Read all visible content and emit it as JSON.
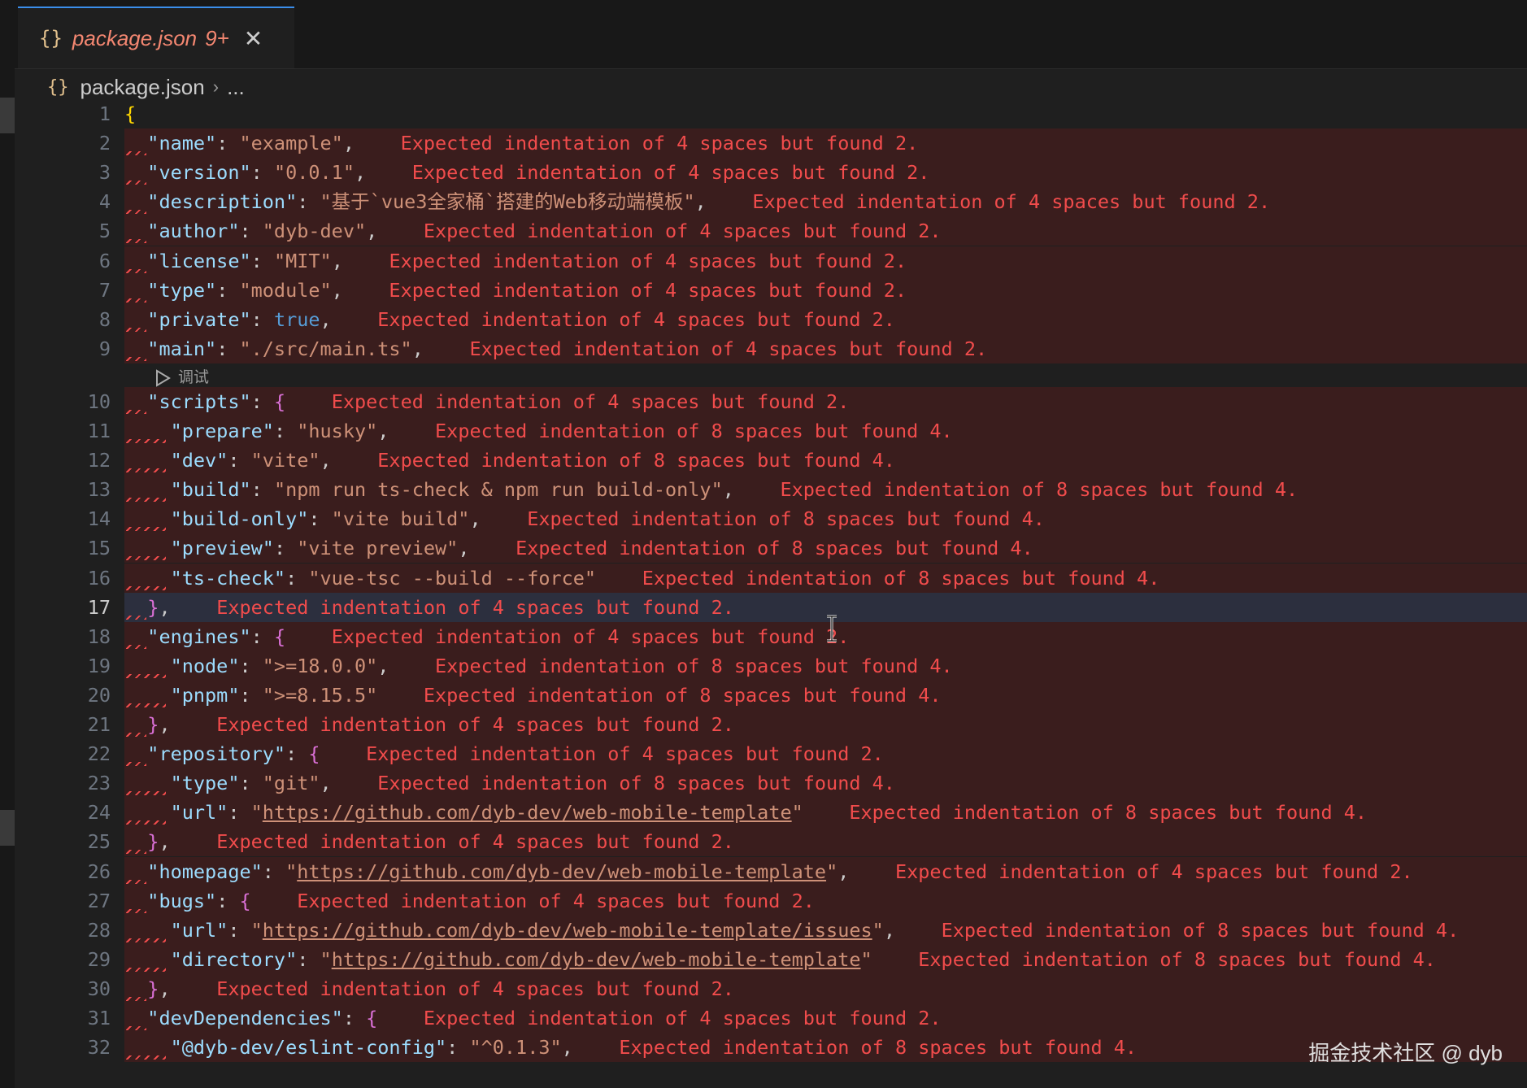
{
  "tab": {
    "icon": "{}",
    "filename": "package.json",
    "problem_count": "9+"
  },
  "breadcrumb": {
    "icon": "{}",
    "file": "package.json",
    "rest": "..."
  },
  "codelens": {
    "label": "调试"
  },
  "watermark": "掘金技术社区 @ dyb",
  "lines": [
    {
      "n": "1",
      "tokens": [
        [
          "br1",
          "{"
        ]
      ],
      "msg": ""
    },
    {
      "n": "2",
      "tokens": [
        [
          "p",
          "  "
        ],
        [
          "k",
          "\"name\""
        ],
        [
          "p",
          ": "
        ],
        [
          "s",
          "\"example\""
        ],
        [
          "p",
          ","
        ]
      ],
      "msg": "Expected indentation of 4 spaces but found 2."
    },
    {
      "n": "3",
      "tokens": [
        [
          "p",
          "  "
        ],
        [
          "k",
          "\"version\""
        ],
        [
          "p",
          ": "
        ],
        [
          "s",
          "\"0.0.1\""
        ],
        [
          "p",
          ","
        ]
      ],
      "msg": "Expected indentation of 4 spaces but found 2."
    },
    {
      "n": "4",
      "tokens": [
        [
          "p",
          "  "
        ],
        [
          "k",
          "\"description\""
        ],
        [
          "p",
          ": "
        ],
        [
          "s",
          "\"基于`vue3全家桶`搭建的Web移动端模板\""
        ],
        [
          "p",
          ","
        ]
      ],
      "msg": "Expected indentation of 4 spaces but found 2."
    },
    {
      "n": "5",
      "tokens": [
        [
          "p",
          "  "
        ],
        [
          "k",
          "\"author\""
        ],
        [
          "p",
          ": "
        ],
        [
          "s",
          "\"dyb-dev\""
        ],
        [
          "p",
          ","
        ]
      ],
      "msg": "Expected indentation of 4 spaces but found 2."
    },
    {
      "n": "6",
      "tokens": [
        [
          "p",
          "  "
        ],
        [
          "k",
          "\"license\""
        ],
        [
          "p",
          ": "
        ],
        [
          "s",
          "\"MIT\""
        ],
        [
          "p",
          ","
        ]
      ],
      "msg": "Expected indentation of 4 spaces but found 2."
    },
    {
      "n": "7",
      "tokens": [
        [
          "p",
          "  "
        ],
        [
          "k",
          "\"type\""
        ],
        [
          "p",
          ": "
        ],
        [
          "s",
          "\"module\""
        ],
        [
          "p",
          ","
        ]
      ],
      "msg": "Expected indentation of 4 spaces but found 2."
    },
    {
      "n": "8",
      "tokens": [
        [
          "p",
          "  "
        ],
        [
          "k",
          "\"private\""
        ],
        [
          "p",
          ": "
        ],
        [
          "b",
          "true"
        ],
        [
          "p",
          ","
        ]
      ],
      "msg": "Expected indentation of 4 spaces but found 2."
    },
    {
      "n": "9",
      "tokens": [
        [
          "p",
          "  "
        ],
        [
          "k",
          "\"main\""
        ],
        [
          "p",
          ": "
        ],
        [
          "s",
          "\"./src/main.ts\""
        ],
        [
          "p",
          ","
        ]
      ],
      "msg": "Expected indentation of 4 spaces but found 2."
    },
    {
      "n": "10",
      "tokens": [
        [
          "p",
          "  "
        ],
        [
          "k",
          "\"scripts\""
        ],
        [
          "p",
          ": "
        ],
        [
          "br",
          "{"
        ]
      ],
      "msg": "Expected indentation of 4 spaces but found 2."
    },
    {
      "n": "11",
      "tokens": [
        [
          "p",
          "    "
        ],
        [
          "k",
          "\"prepare\""
        ],
        [
          "p",
          ": "
        ],
        [
          "s",
          "\"husky\""
        ],
        [
          "p",
          ","
        ]
      ],
      "msg": "Expected indentation of 8 spaces but found 4."
    },
    {
      "n": "12",
      "tokens": [
        [
          "p",
          "    "
        ],
        [
          "k",
          "\"dev\""
        ],
        [
          "p",
          ": "
        ],
        [
          "s",
          "\"vite\""
        ],
        [
          "p",
          ","
        ]
      ],
      "msg": "Expected indentation of 8 spaces but found 4."
    },
    {
      "n": "13",
      "tokens": [
        [
          "p",
          "    "
        ],
        [
          "k",
          "\"build\""
        ],
        [
          "p",
          ": "
        ],
        [
          "s",
          "\"npm run ts-check & npm run build-only\""
        ],
        [
          "p",
          ","
        ]
      ],
      "msg": "Expected indentation of 8 spaces but found 4."
    },
    {
      "n": "14",
      "tokens": [
        [
          "p",
          "    "
        ],
        [
          "k",
          "\"build-only\""
        ],
        [
          "p",
          ": "
        ],
        [
          "s",
          "\"vite build\""
        ],
        [
          "p",
          ","
        ]
      ],
      "msg": "Expected indentation of 8 spaces but found 4."
    },
    {
      "n": "15",
      "tokens": [
        [
          "p",
          "    "
        ],
        [
          "k",
          "\"preview\""
        ],
        [
          "p",
          ": "
        ],
        [
          "s",
          "\"vite preview\""
        ],
        [
          "p",
          ","
        ]
      ],
      "msg": "Expected indentation of 8 spaces but found 4."
    },
    {
      "n": "16",
      "tokens": [
        [
          "p",
          "    "
        ],
        [
          "k",
          "\"ts-check\""
        ],
        [
          "p",
          ": "
        ],
        [
          "s",
          "\"vue-tsc --build --force\""
        ]
      ],
      "msg": "Expected indentation of 8 spaces but found 4."
    },
    {
      "n": "17",
      "tokens": [
        [
          "p",
          "  "
        ],
        [
          "br",
          "}"
        ],
        [
          "p",
          ","
        ]
      ],
      "msg": "Expected indentation of 4 spaces but found 2.",
      "active": true
    },
    {
      "n": "18",
      "tokens": [
        [
          "p",
          "  "
        ],
        [
          "k",
          "\"engines\""
        ],
        [
          "p",
          ": "
        ],
        [
          "br",
          "{"
        ]
      ],
      "msg": "Expected indentation of 4 spaces but found 2."
    },
    {
      "n": "19",
      "tokens": [
        [
          "p",
          "    "
        ],
        [
          "k",
          "\"node\""
        ],
        [
          "p",
          ": "
        ],
        [
          "s",
          "\">=18.0.0\""
        ],
        [
          "p",
          ","
        ]
      ],
      "msg": "Expected indentation of 8 spaces but found 4."
    },
    {
      "n": "20",
      "tokens": [
        [
          "p",
          "    "
        ],
        [
          "k",
          "\"pnpm\""
        ],
        [
          "p",
          ": "
        ],
        [
          "s",
          "\">=8.15.5\""
        ]
      ],
      "msg": "Expected indentation of 8 spaces but found 4."
    },
    {
      "n": "21",
      "tokens": [
        [
          "p",
          "  "
        ],
        [
          "br",
          "}"
        ],
        [
          "p",
          ","
        ]
      ],
      "msg": "Expected indentation of 4 spaces but found 2."
    },
    {
      "n": "22",
      "tokens": [
        [
          "p",
          "  "
        ],
        [
          "k",
          "\"repository\""
        ],
        [
          "p",
          ": "
        ],
        [
          "br",
          "{"
        ]
      ],
      "msg": "Expected indentation of 4 spaces but found 2."
    },
    {
      "n": "23",
      "tokens": [
        [
          "p",
          "    "
        ],
        [
          "k",
          "\"type\""
        ],
        [
          "p",
          ": "
        ],
        [
          "s",
          "\"git\""
        ],
        [
          "p",
          ","
        ]
      ],
      "msg": "Expected indentation of 8 spaces but found 4."
    },
    {
      "n": "24",
      "tokens": [
        [
          "p",
          "    "
        ],
        [
          "k",
          "\"url\""
        ],
        [
          "p",
          ": "
        ],
        [
          "s",
          "\""
        ],
        [
          "u",
          "https://github.com/dyb-dev/web-mobile-template"
        ],
        [
          "s",
          "\""
        ]
      ],
      "msg": "Expected indentation of 8 spaces but found 4."
    },
    {
      "n": "25",
      "tokens": [
        [
          "p",
          "  "
        ],
        [
          "br",
          "}"
        ],
        [
          "p",
          ","
        ]
      ],
      "msg": "Expected indentation of 4 spaces but found 2."
    },
    {
      "n": "26",
      "tokens": [
        [
          "p",
          "  "
        ],
        [
          "k",
          "\"homepage\""
        ],
        [
          "p",
          ": "
        ],
        [
          "s",
          "\""
        ],
        [
          "u",
          "https://github.com/dyb-dev/web-mobile-template"
        ],
        [
          "s",
          "\""
        ],
        [
          "p",
          ","
        ]
      ],
      "msg": "Expected indentation of 4 spaces but found 2."
    },
    {
      "n": "27",
      "tokens": [
        [
          "p",
          "  "
        ],
        [
          "k",
          "\"bugs\""
        ],
        [
          "p",
          ": "
        ],
        [
          "br",
          "{"
        ]
      ],
      "msg": "Expected indentation of 4 spaces but found 2."
    },
    {
      "n": "28",
      "tokens": [
        [
          "p",
          "    "
        ],
        [
          "k",
          "\"url\""
        ],
        [
          "p",
          ": "
        ],
        [
          "s",
          "\""
        ],
        [
          "u",
          "https://github.com/dyb-dev/web-mobile-template/issues"
        ],
        [
          "s",
          "\""
        ],
        [
          "p",
          ","
        ]
      ],
      "msg": "Expected indentation of 8 spaces but found 4."
    },
    {
      "n": "29",
      "tokens": [
        [
          "p",
          "    "
        ],
        [
          "k",
          "\"directory\""
        ],
        [
          "p",
          ": "
        ],
        [
          "s",
          "\""
        ],
        [
          "u",
          "https://github.com/dyb-dev/web-mobile-template"
        ],
        [
          "s",
          "\""
        ]
      ],
      "msg": "Expected indentation of 8 spaces but found 4."
    },
    {
      "n": "30",
      "tokens": [
        [
          "p",
          "  "
        ],
        [
          "br",
          "}"
        ],
        [
          "p",
          ","
        ]
      ],
      "msg": "Expected indentation of 4 spaces but found 2."
    },
    {
      "n": "31",
      "tokens": [
        [
          "p",
          "  "
        ],
        [
          "k",
          "\"devDependencies\""
        ],
        [
          "p",
          ": "
        ],
        [
          "br",
          "{"
        ]
      ],
      "msg": "Expected indentation of 4 spaces but found 2."
    },
    {
      "n": "32",
      "tokens": [
        [
          "p",
          "    "
        ],
        [
          "k",
          "\"@dyb-dev/eslint-config\""
        ],
        [
          "p",
          ": "
        ],
        [
          "s",
          "\"^0.1.3\""
        ],
        [
          "p",
          ","
        ]
      ],
      "msg": "Expected indentation of 8 spaces but found 4."
    }
  ]
}
